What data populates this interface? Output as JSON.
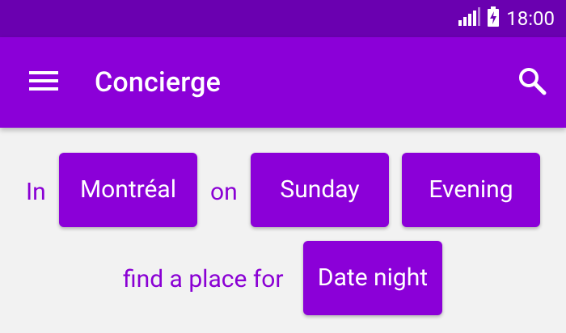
{
  "status_bar": {
    "time": "18:00",
    "icons": [
      "signal-icon",
      "battery-charging-icon"
    ]
  },
  "app_bar": {
    "title": "Concierge",
    "menu_icon": "menu-icon",
    "search_icon": "search-icon"
  },
  "query": {
    "in_label": "In",
    "city": "Montréal",
    "on_label": "on",
    "day": "Sunday",
    "time_of_day": "Evening",
    "find_label": "find a place for",
    "occasion": "Date night"
  },
  "colors": {
    "status_bar": "#6a00b0",
    "primary": "#8b00d8",
    "background": "#f2f2f2",
    "label_text": "#8a00d4"
  }
}
